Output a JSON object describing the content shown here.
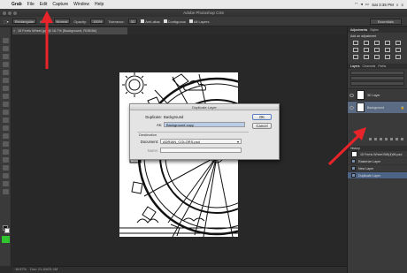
{
  "menubar": {
    "apple_glyph": "",
    "items": [
      "Grab",
      "File",
      "Edit",
      "Capture",
      "Window",
      "Help"
    ],
    "clock": "Sat 3:35 PM"
  },
  "window": {
    "title": "Adobe Photoshop CS6"
  },
  "options": {
    "preset": "Rectangular",
    "mode_label": "Mode:",
    "mode_value": "Normal",
    "opacity_label": "Opacity:",
    "opacity_value": "100%",
    "tolerance_label": "Tolerance:",
    "tolerance_value": "32",
    "antialias": "Anti-alias",
    "contiguous": "Contiguous",
    "all_layers": "All Layers",
    "workspace": "Essentials"
  },
  "document": {
    "tab_title": "15 Ferris Wheel.jpg @ 16.7% (Background, RGB/8#)",
    "close_glyph": "×"
  },
  "dialog": {
    "title": "Duplicate Layer",
    "duplicate_label": "Duplicate:",
    "duplicate_value": "Background",
    "as_label": "As:",
    "as_value": "Background copy",
    "destination_label": "Destination",
    "document_label": "Document:",
    "document_value": "ADRIAN_COLORS.psd",
    "name_label": "Name:",
    "name_value": "",
    "ok_label": "OK",
    "cancel_label": "Cancel"
  },
  "panels": {
    "top_tabs": [
      "Adjustments",
      "Styles"
    ],
    "adjustments_title": "Add an adjustment",
    "layer_tabs": [
      "Layers",
      "Channels",
      "Paths"
    ],
    "layers": [
      {
        "name": "3D Layer"
      },
      {
        "name": "Background"
      }
    ],
    "history_title": "History",
    "history_doc": "15 Ferris Wheel BW(4)96.psd",
    "history_items": [
      "Rasterize Layer",
      "New Layer",
      "Duplicate Layer"
    ]
  },
  "statusbar": {
    "zoom": "16.67%",
    "doc_info": "Doc: 21.1M/21.1M"
  }
}
